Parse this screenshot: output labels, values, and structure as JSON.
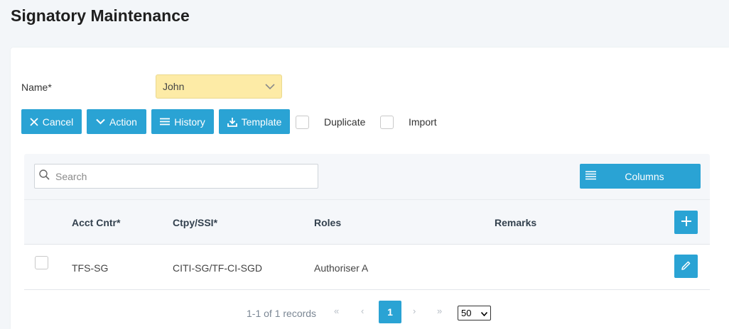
{
  "page": {
    "title": "Signatory Maintenance"
  },
  "form": {
    "name_label": "Name*",
    "name_value": "John"
  },
  "toolbar": {
    "cancel_label": "Cancel",
    "action_label": "Action",
    "history_label": "History",
    "template_label": "Template",
    "duplicate_label": "Duplicate",
    "import_label": "Import"
  },
  "grid": {
    "search_placeholder": "Search",
    "columns_label": "Columns",
    "headers": {
      "acct_cntr": "Acct Cntr*",
      "ctpy_ssi": "Ctpy/SSI*",
      "roles": "Roles",
      "remarks": "Remarks"
    },
    "rows": [
      {
        "acct_cntr": "TFS-SG",
        "ctpy_ssi": "CITI-SG/TF-CI-SGD",
        "roles": "Authoriser A",
        "remarks": ""
      }
    ]
  },
  "pagination": {
    "records_text": "1-1 of 1 records",
    "first": "«",
    "prev": "‹",
    "current_page": "1",
    "next": "›",
    "last": "»",
    "page_size": "50"
  },
  "colors": {
    "accent": "#2aa3d4",
    "name_field_bg": "#fdeba6",
    "page_bg": "#f3f6f9"
  }
}
